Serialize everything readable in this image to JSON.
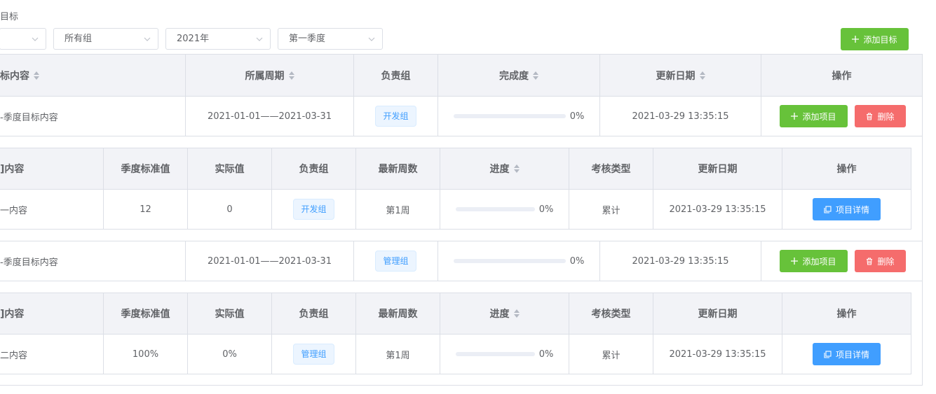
{
  "page": {
    "title": "目标"
  },
  "filters": {
    "first": "",
    "group": "所有组",
    "year": "2021年",
    "quarter": "第一季度",
    "add_goal": "添加目标"
  },
  "goal_table": {
    "headers": [
      "标内容",
      "所属周期",
      "负责组",
      "完成度",
      "更新日期",
      "操作"
    ],
    "rows": [
      {
        "content": "-季度目标内容",
        "period": "2021-01-01——2021-03-31",
        "group": "开发组",
        "progress": "0%",
        "updated": "2021-03-29 13:35:15",
        "add_project": "添加项目",
        "delete": "删除"
      },
      {
        "content": "-季度目标内容",
        "period": "2021-01-01——2021-03-31",
        "group": "管理组",
        "progress": "0%",
        "updated": "2021-03-29 13:35:15",
        "add_project": "添加项目",
        "delete": "删除"
      }
    ]
  },
  "project_table": {
    "headers": [
      "]内容",
      "季度标准值",
      "实际值",
      "负责组",
      "最新周数",
      "进度",
      "考核类型",
      "更新日期",
      "操作"
    ],
    "rows": [
      {
        "content": "一内容",
        "standard": "12",
        "actual": "0",
        "group": "开发组",
        "week": "第1周",
        "progress": "0%",
        "type": "累计",
        "updated": "2021-03-29 13:35:15",
        "detail": "项目详情"
      },
      {
        "content": "二内容",
        "standard": "100%",
        "actual": "0%",
        "group": "管理组",
        "week": "第1周",
        "progress": "0%",
        "type": "累计",
        "updated": "2021-03-29 13:35:15",
        "detail": "项目详情"
      }
    ]
  }
}
